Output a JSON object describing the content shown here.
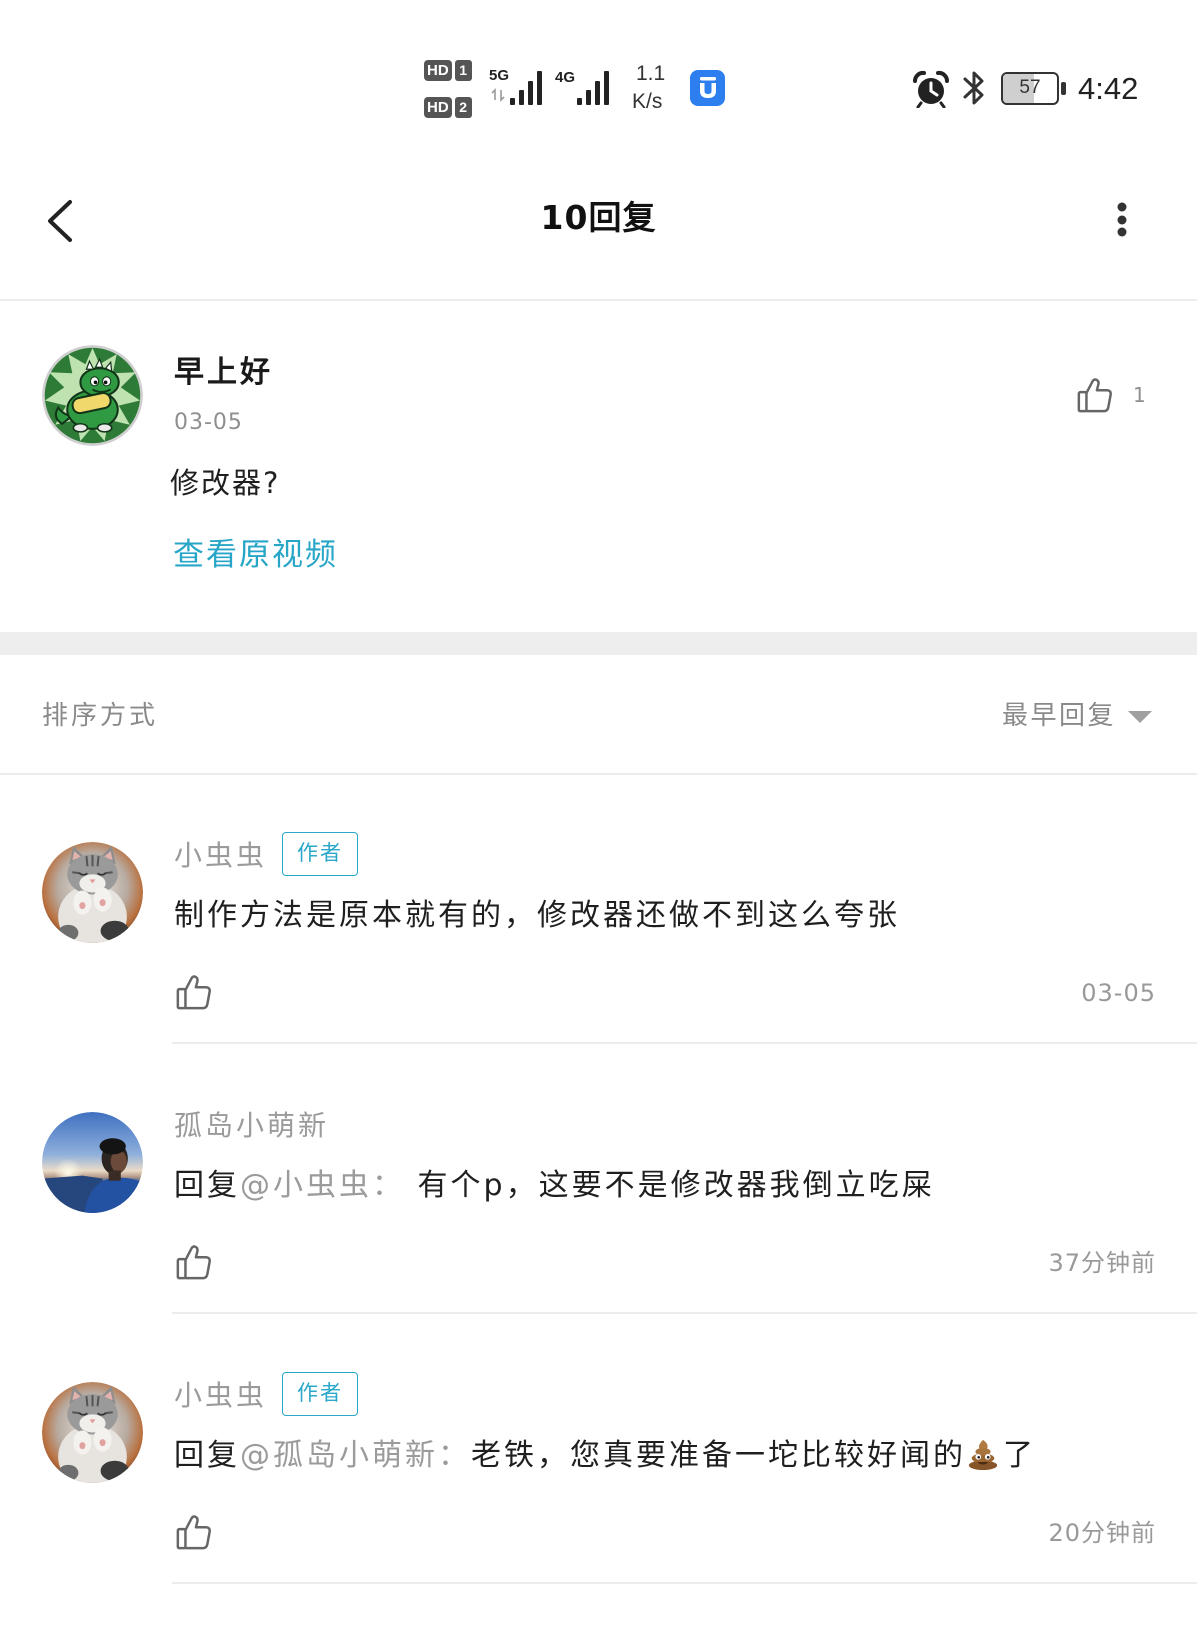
{
  "status_bar": {
    "sim_cards": [
      {
        "label": "HD",
        "slot": "1"
      },
      {
        "label": "HD",
        "slot": "2"
      }
    ],
    "networks": [
      {
        "type": "5G",
        "bars": 4,
        "icon": "signal-bars-icon"
      },
      {
        "type": "4G",
        "bars": 4,
        "icon": "signal-bars-icon"
      }
    ],
    "net_speed": {
      "value": "1.1",
      "unit": "K/s"
    },
    "notification_icon": "app-notification-icon",
    "alarm_icon": "alarm-clock-icon",
    "bluetooth_icon": "bluetooth-icon",
    "battery": {
      "level": "57",
      "icon": "battery-icon"
    },
    "time": "4:42"
  },
  "header": {
    "back_icon": "chevron-left-icon",
    "title": "10回复",
    "more_icon": "more-vertical-icon"
  },
  "post": {
    "author": "早上好",
    "date": "03-05",
    "text": "修改器?",
    "link": "查看原视频",
    "like_icon": "thumbs-up-icon",
    "like_count": "1"
  },
  "sort": {
    "label": "排序方式",
    "selected": "最早回复",
    "dropdown_icon": "caret-down-icon"
  },
  "comments": [
    {
      "author": "小虫虫",
      "badge": "作者",
      "text": "制作方法是原本就有的，修改器还做不到这么夸张",
      "like_icon": "thumbs-up-icon",
      "time": "03-05"
    },
    {
      "author": "孤岛小萌新",
      "reply_prefix": "回复",
      "mention": "@小虫虫：",
      "text": " 有个p，这要不是修改器我倒立吃屎",
      "like_icon": "thumbs-up-icon",
      "time": "37分钟前"
    },
    {
      "author": "小虫虫",
      "badge": "作者",
      "reply_prefix": "回复",
      "mention": "@孤岛小萌新：",
      "text": "老铁，您真要准备一坨比较好闻的",
      "emoji": "poop-emoji-icon",
      "text_after": "了",
      "like_icon": "thumbs-up-icon",
      "time": "20分钟前"
    }
  ],
  "colors": {
    "text": "#1f1f1f",
    "muted": "#999999",
    "accent": "#27a6c8",
    "divider": "#ececec",
    "section_gap": "#eeeeee"
  }
}
